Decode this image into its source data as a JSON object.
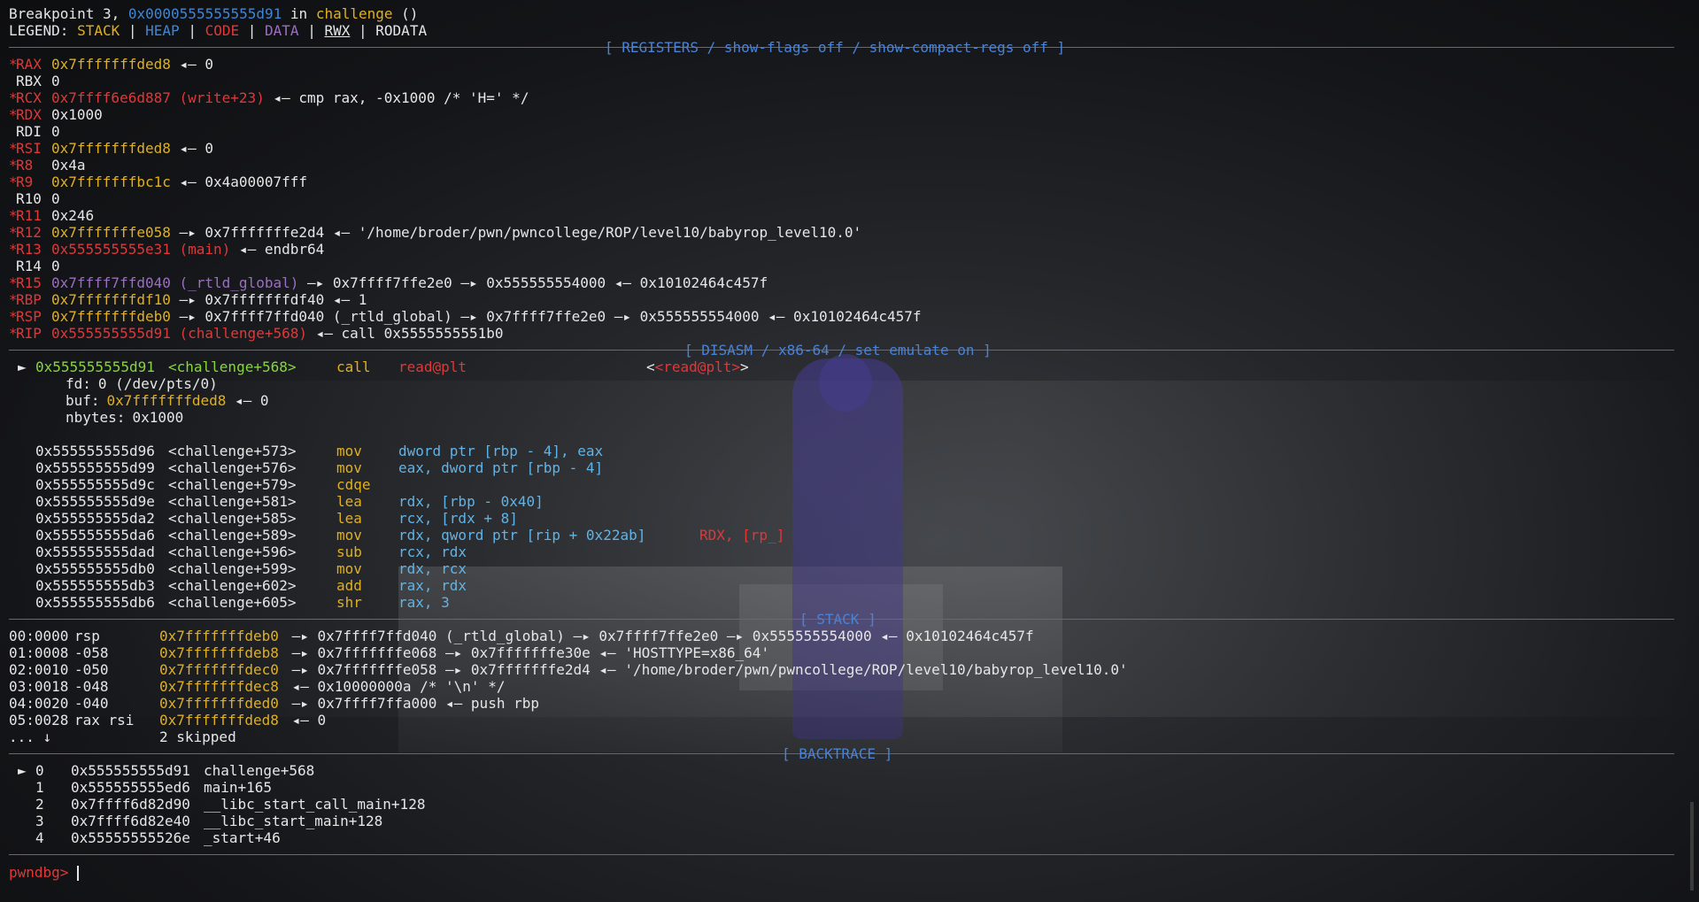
{
  "header": {
    "breakpoint_prefix": "Breakpoint 3,",
    "breakpoint_addr": "0x0000555555555d91",
    "breakpoint_in": "in",
    "breakpoint_func": "challenge",
    "breakpoint_suffix": "()",
    "legend_label": "LEGEND:",
    "legend": [
      "STACK",
      "HEAP",
      "CODE",
      "DATA",
      "RWX",
      "RODATA"
    ]
  },
  "sections": {
    "registers": "[ REGISTERS / show-flags off / show-compact-regs off ]",
    "disasm": "[ DISASM / x86-64 / set emulate on ]",
    "stack": "[ STACK ]",
    "backtrace": "[ BACKTRACE ]"
  },
  "registers": [
    {
      "mark": "*",
      "name": "RAX",
      "val": "0x7fffffffded8",
      "rest": " ◂— 0"
    },
    {
      "mark": " ",
      "name": "RBX",
      "val": "0",
      "rest": ""
    },
    {
      "mark": "*",
      "name": "RCX",
      "val": "0x7ffff6e6d887 (write+23)",
      "rest": " ◂— cmp rax, -0x1000 /* 'H=' */"
    },
    {
      "mark": "*",
      "name": "RDX",
      "val": "0x1000",
      "rest": ""
    },
    {
      "mark": " ",
      "name": "RDI",
      "val": "0",
      "rest": ""
    },
    {
      "mark": "*",
      "name": "RSI",
      "val": "0x7fffffffded8",
      "rest": " ◂— 0"
    },
    {
      "mark": "*",
      "name": "R8",
      "val": "0x4a",
      "rest": ""
    },
    {
      "mark": "*",
      "name": "R9",
      "val": "0x7fffffffbc1c",
      "rest": " ◂— 0x4a00007fff"
    },
    {
      "mark": " ",
      "name": "R10",
      "val": "0",
      "rest": ""
    },
    {
      "mark": "*",
      "name": "R11",
      "val": "0x246",
      "rest": ""
    },
    {
      "mark": "*",
      "name": "R12",
      "val": "0x7fffffffe058",
      "rest": " —▸ 0x7fffffffe2d4 ◂— '/home/broder/pwn/pwncollege/ROP/level10/babyrop_level10.0'"
    },
    {
      "mark": "*",
      "name": "R13",
      "val": "0x555555555e31 (main)",
      "rest": " ◂— endbr64"
    },
    {
      "mark": " ",
      "name": "R14",
      "val": "0",
      "rest": ""
    },
    {
      "mark": "*",
      "name": "R15",
      "val": "0x7ffff7ffd040 (_rtld_global)",
      "rest": " —▸ 0x7ffff7ffe2e0 —▸ 0x555555554000 ◂— 0x10102464c457f"
    },
    {
      "mark": "*",
      "name": "RBP",
      "val": "0x7fffffffdf10",
      "rest": " —▸ 0x7fffffffdf40 ◂— 1"
    },
    {
      "mark": "*",
      "name": "RSP",
      "val": "0x7fffffffdeb0",
      "rest": " —▸ 0x7ffff7ffd040 (_rtld_global) —▸ 0x7ffff7ffe2e0 —▸ 0x555555554000 ◂— 0x10102464c457f"
    },
    {
      "mark": "*",
      "name": "RIP",
      "val": "0x555555555d91 (challenge+568)",
      "rest": " ◂— call 0x5555555551b0"
    }
  ],
  "disasm": {
    "current": {
      "arrow": "►",
      "addr": "0x555555555d91",
      "sym": "<challenge+568>",
      "mnem": "call",
      "ops": "read@plt",
      "target": "<read@plt>"
    },
    "args": [
      {
        "name": "fd:",
        "val": "0 (/dev/pts/0)",
        "rest": ""
      },
      {
        "name": "buf:",
        "val": "0x7fffffffded8",
        "rest": " ◂— 0"
      },
      {
        "name": "nbytes:",
        "val": "0x1000",
        "rest": ""
      }
    ],
    "rows": [
      {
        "addr": "0x555555555d96",
        "sym": "<challenge+573>",
        "mnem": "mov",
        "ops": "dword ptr [rbp - 4], eax",
        "extra": ""
      },
      {
        "addr": "0x555555555d99",
        "sym": "<challenge+576>",
        "mnem": "mov",
        "ops": "eax, dword ptr [rbp - 4]",
        "extra": ""
      },
      {
        "addr": "0x555555555d9c",
        "sym": "<challenge+579>",
        "mnem": "cdqe",
        "ops": "",
        "extra": ""
      },
      {
        "addr": "0x555555555d9e",
        "sym": "<challenge+581>",
        "mnem": "lea",
        "ops": "rdx, [rbp - 0x40]",
        "extra": ""
      },
      {
        "addr": "0x555555555da2",
        "sym": "<challenge+585>",
        "mnem": "lea",
        "ops": "rcx, [rdx + 8]",
        "extra": ""
      },
      {
        "addr": "0x555555555da6",
        "sym": "<challenge+589>",
        "mnem": "mov",
        "ops": "rdx, qword ptr [rip + 0x22ab]",
        "extra": "RDX, [rp_]"
      },
      {
        "addr": "0x555555555dad",
        "sym": "<challenge+596>",
        "mnem": "sub",
        "ops": "rcx, rdx",
        "extra": ""
      },
      {
        "addr": "0x555555555db0",
        "sym": "<challenge+599>",
        "mnem": "mov",
        "ops": "rdx, rcx",
        "extra": ""
      },
      {
        "addr": "0x555555555db3",
        "sym": "<challenge+602>",
        "mnem": "add",
        "ops": "rax, rdx",
        "extra": ""
      },
      {
        "addr": "0x555555555db6",
        "sym": "<challenge+605>",
        "mnem": "shr",
        "ops": "rax, 3",
        "extra": ""
      }
    ]
  },
  "stack": [
    {
      "idx": "00:0000",
      "off": "rsp",
      "addr": "0x7fffffffdeb0",
      "rest": " —▸ 0x7ffff7ffd040 (_rtld_global) —▸ 0x7ffff7ffe2e0 —▸ 0x555555554000 ◂— 0x10102464c457f"
    },
    {
      "idx": "01:0008",
      "off": "-058",
      "addr": "0x7fffffffdeb8",
      "rest": " —▸ 0x7fffffffe068 —▸ 0x7fffffffe30e ◂— 'HOSTTYPE=x86_64'"
    },
    {
      "idx": "02:0010",
      "off": "-050",
      "addr": "0x7fffffffdec0",
      "rest": " —▸ 0x7fffffffe058 —▸ 0x7fffffffe2d4 ◂— '/home/broder/pwn/pwncollege/ROP/level10/babyrop_level10.0'"
    },
    {
      "idx": "03:0018",
      "off": "-048",
      "addr": "0x7fffffffdec8",
      "rest": " ◂— 0x10000000a /* '\\n' */"
    },
    {
      "idx": "04:0020",
      "off": "-040",
      "addr": "0x7fffffffded0",
      "rest": " —▸ 0x7ffff7ffa000 ◂— push rbp"
    },
    {
      "idx": "05:0028",
      "off": "rax rsi",
      "addr": "0x7fffffffded8",
      "rest": " ◂— 0"
    }
  ],
  "stack_skip": {
    "dots": "... ↓",
    "text": "2 skipped"
  },
  "backtrace": [
    {
      "mark": "►",
      "n": "0",
      "addr": "0x555555555d91",
      "sym": "challenge+568"
    },
    {
      "mark": " ",
      "n": "1",
      "addr": "0x555555555ed6",
      "sym": "main+165"
    },
    {
      "mark": " ",
      "n": "2",
      "addr": "0x7ffff6d82d90",
      "sym": "__libc_start_call_main+128"
    },
    {
      "mark": " ",
      "n": "3",
      "addr": "0x7ffff6d82e40",
      "sym": "__libc_start_main+128"
    },
    {
      "mark": " ",
      "n": "4",
      "addr": "0x55555555526e",
      "sym": "_start+46"
    }
  ],
  "prompt": "pwndbg>"
}
